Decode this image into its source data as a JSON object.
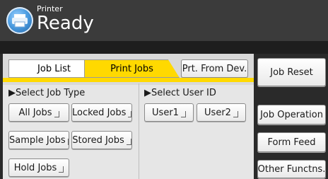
{
  "header": {
    "device_label": "Printer",
    "status": "Ready",
    "icon": "printer-icon"
  },
  "tabs": [
    {
      "label": "Job List",
      "active": false
    },
    {
      "label": "Print Jobs",
      "active": true
    },
    {
      "label": "Prt. From Dev.",
      "active": false
    }
  ],
  "select_job_type": {
    "title": "▶Select Job Type",
    "buttons": [
      "All Jobs",
      "Locked Jobs",
      "Sample Jobs",
      "Stored Jobs",
      "Hold Jobs"
    ]
  },
  "select_user_id": {
    "title": "▶Select User ID",
    "buttons": [
      "User1",
      "User2"
    ]
  },
  "right_buttons": {
    "job_reset": "Job Reset",
    "job_operation": "Job Operation",
    "form_feed": "Form Feed",
    "other_functions": "Other Functns."
  },
  "colors": {
    "accent": "#ffd900",
    "header": "#3b3b3b",
    "panel": "#e6e6e6"
  }
}
